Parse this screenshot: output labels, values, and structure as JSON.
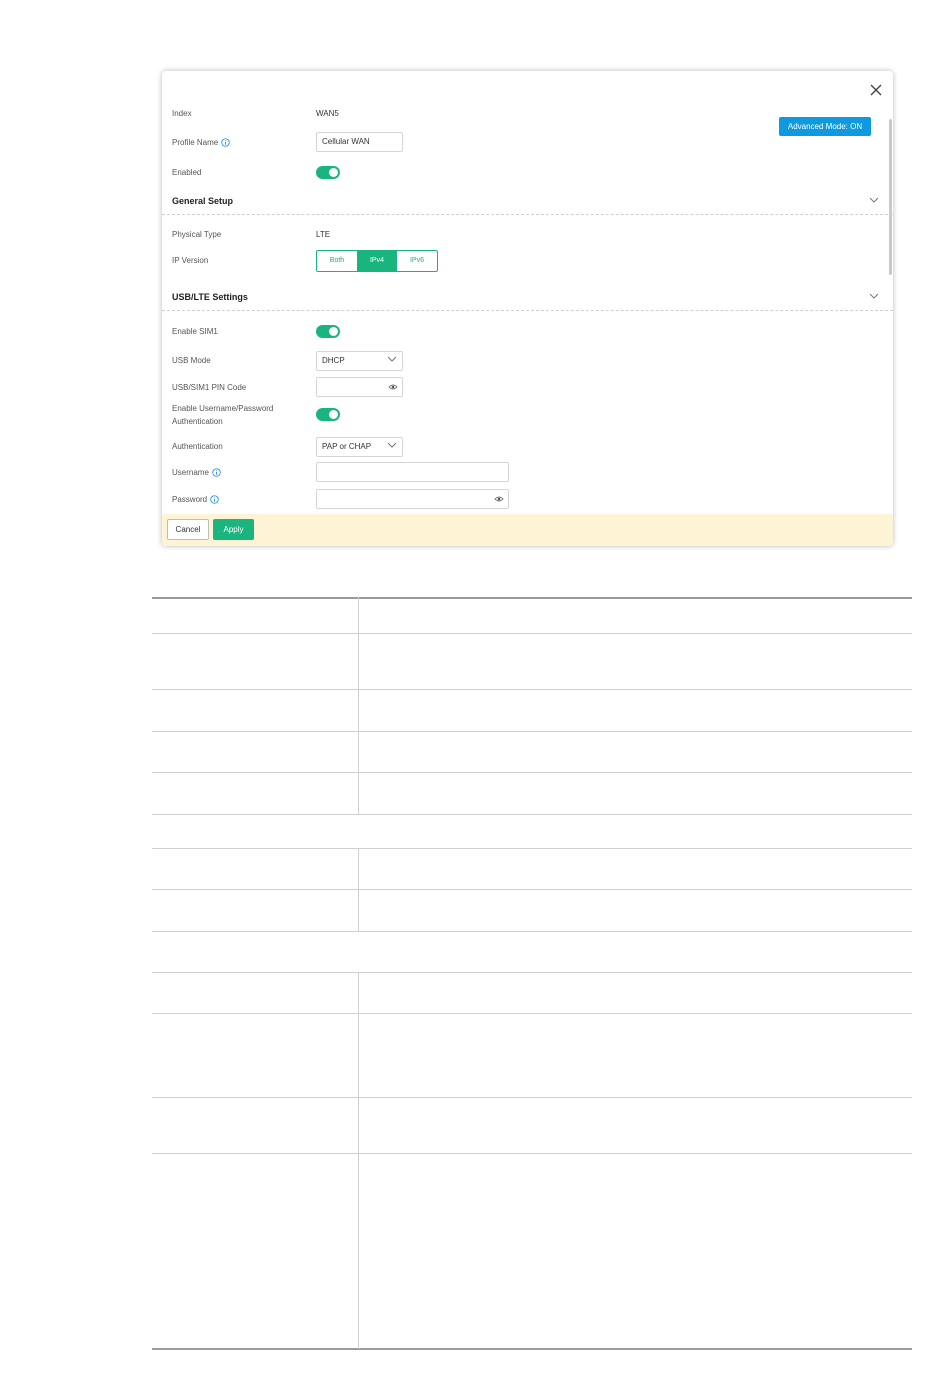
{
  "dialog": {
    "advanced_mode_label": "Advanced Mode: ON",
    "fields": {
      "index_label": "Index",
      "index_value": "WAN5",
      "profile_name_label": "Profile Name",
      "profile_name_value": "Cellular WAN",
      "enabled_label": "Enabled"
    },
    "general_setup": {
      "title": "General Setup",
      "physical_type_label": "Physical Type",
      "physical_type_value": "LTE",
      "ip_version_label": "IP Version",
      "ip_version_options": [
        "Both",
        "IPv4",
        "IPv6"
      ],
      "ip_version_selected": "IPv4"
    },
    "usb_lte": {
      "title": "USB/LTE Settings",
      "enable_sim1_label": "Enable SIM1",
      "usb_mode_label": "USB Mode",
      "usb_mode_value": "DHCP",
      "pin_code_label": "USB/SIM1 PIN Code",
      "pin_code_value": "",
      "auth_toggle_label_line1": "Enable Username/Password",
      "auth_toggle_label_line2": "Authentication",
      "authentication_label": "Authentication",
      "authentication_value": "PAP or CHAP",
      "username_label": "Username",
      "username_value": "",
      "password_label": "Password",
      "password_value": ""
    },
    "footer": {
      "cancel_label": "Cancel",
      "apply_label": "Apply"
    }
  },
  "colors": {
    "accent_green": "#1ab57e",
    "accent_blue": "#0f9ae0",
    "footer_bg": "#fdf4d6"
  },
  "icons": [
    "close-icon",
    "info-icon",
    "chevron-down-icon",
    "eye-icon"
  ]
}
